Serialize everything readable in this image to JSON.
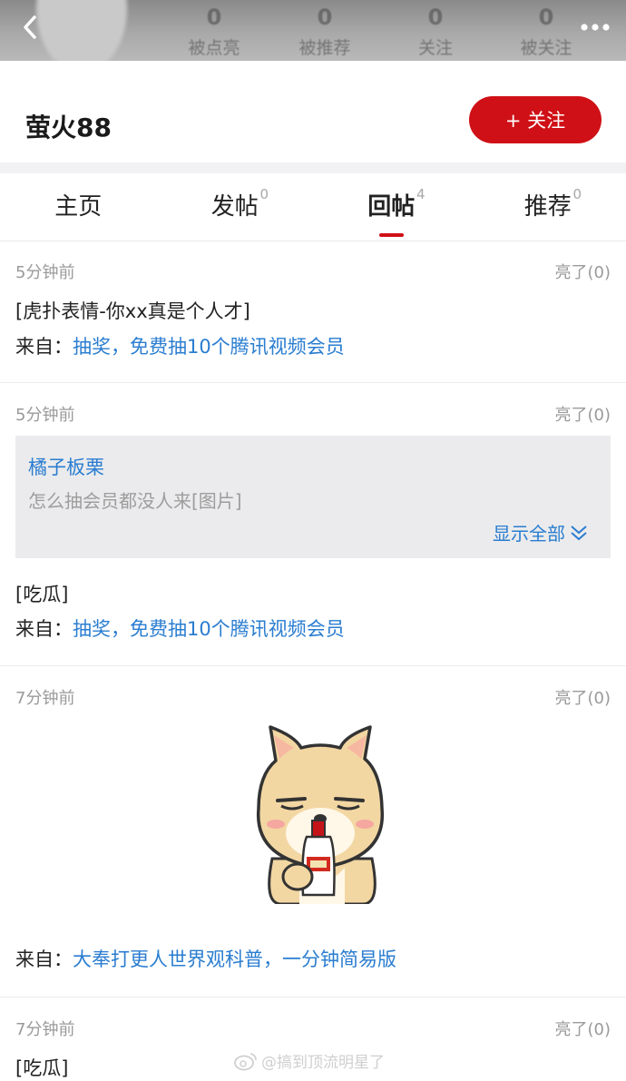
{
  "header": {
    "stats": [
      {
        "value": "0",
        "label": "被点亮"
      },
      {
        "value": "0",
        "label": "被推荐"
      },
      {
        "value": "0",
        "label": "关注"
      },
      {
        "value": "0",
        "label": "被关注"
      }
    ]
  },
  "profile": {
    "username": "萤火88",
    "follow_label": "+ 关注"
  },
  "tabs": [
    {
      "label": "主页",
      "count": ""
    },
    {
      "label": "发帖",
      "count": "0"
    },
    {
      "label": "回帖",
      "count": "4"
    },
    {
      "label": "推荐",
      "count": "0"
    }
  ],
  "posts": [
    {
      "time": "5分钟前",
      "liked": "亮了(0)",
      "content": "[虎扑表情-你xx真是个人才]",
      "source_prefix": "来自：",
      "source_title": "抽奖，免费抽10个腾讯视频会员"
    },
    {
      "time": "5分钟前",
      "liked": "亮了(0)",
      "quote_user": "橘子板栗",
      "quote_text": "怎么抽会员都没人来[图片]",
      "quote_more": "显示全部",
      "content": "[吃瓜]",
      "source_prefix": "来自：",
      "source_title": "抽奖，免费抽10个腾讯视频会员"
    },
    {
      "time": "7分钟前",
      "liked": "亮了(0)",
      "image": "shiba-dog-drinking-sticker",
      "source_prefix": "来自：",
      "source_title": "大奉打更人世界观科普，一分钟简易版"
    },
    {
      "time": "7分钟前",
      "liked": "亮了(0)",
      "content": "[吃瓜]"
    }
  ],
  "watermark": "@搞到顶流明星了",
  "colors": {
    "accent": "#cf1016",
    "link": "#2a7dd0",
    "muted": "#9a9a9a"
  },
  "active_tab": 2
}
